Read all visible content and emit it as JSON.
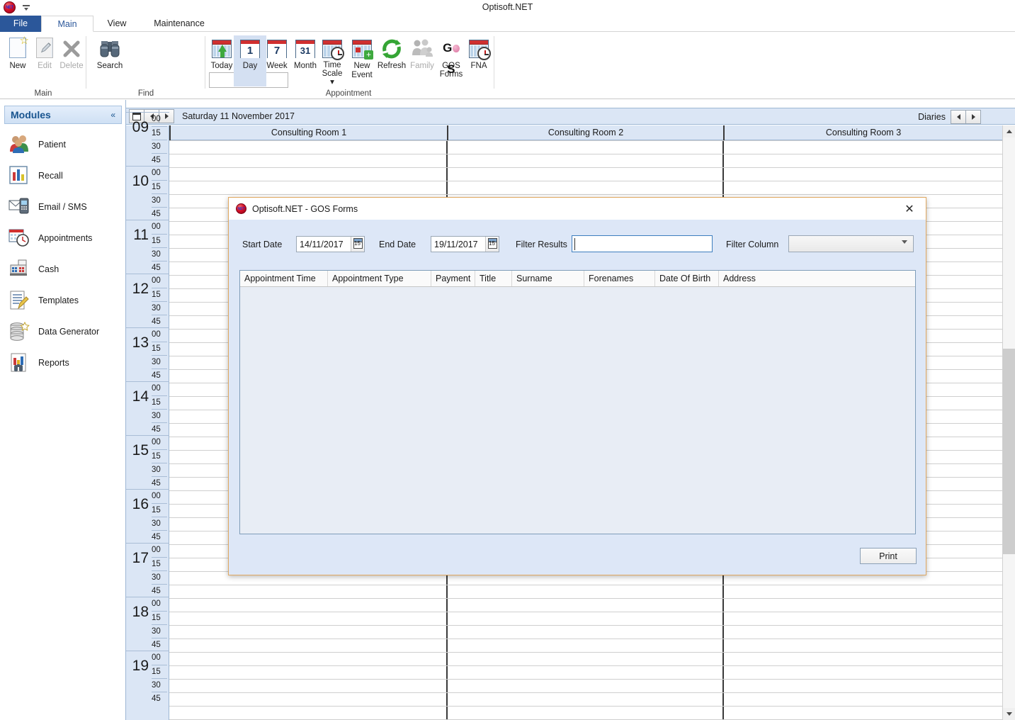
{
  "window": {
    "title": "Optisoft.NET",
    "app_icon": "app-orb-icon",
    "qat_dropdown": "customize-quick-access-icon"
  },
  "ribbon": {
    "tabs": [
      {
        "label": "File",
        "active": false
      },
      {
        "label": "Main",
        "active": true
      },
      {
        "label": "View",
        "active": false
      },
      {
        "label": "Maintenance",
        "active": false
      }
    ],
    "groups": [
      {
        "name": "Main",
        "label": "Main",
        "buttons": [
          {
            "label": "New",
            "icon": "new-page-icon",
            "enabled": true
          },
          {
            "label": "Edit",
            "icon": "edit-pencil-icon",
            "enabled": false
          },
          {
            "label": "Delete",
            "icon": "delete-x-icon",
            "enabled": false
          }
        ]
      },
      {
        "name": "Find",
        "label": "Find",
        "buttons": [
          {
            "label": "Search",
            "icon": "binoculars-icon",
            "enabled": true
          }
        ],
        "search_value": "",
        "search_placeholder": ""
      },
      {
        "name": "Appointment",
        "label": "Appointment",
        "buttons": [
          {
            "label": "Today",
            "icon": "calendar-today-icon",
            "enabled": true,
            "selected": false
          },
          {
            "label": "Day",
            "icon": "calendar-day-icon",
            "enabled": true,
            "selected": true
          },
          {
            "label": "Week",
            "icon": "calendar-week-icon",
            "enabled": true,
            "selected": false
          },
          {
            "label": "Month",
            "icon": "calendar-month-icon",
            "enabled": true,
            "selected": false
          },
          {
            "label": "Time Scale",
            "icon": "calendar-clock-icon",
            "enabled": true,
            "selected": false,
            "has_dropdown": true
          },
          {
            "label": "New Event",
            "icon": "calendar-add-icon",
            "enabled": true,
            "selected": false
          },
          {
            "label": "Refresh",
            "icon": "refresh-icon",
            "enabled": true,
            "selected": false
          },
          {
            "label": "Family",
            "icon": "family-icon",
            "enabled": false,
            "selected": false
          },
          {
            "label": "GOS Forms",
            "icon": "gos-icon",
            "enabled": true,
            "selected": false
          },
          {
            "label": "FNA",
            "icon": "calendar-clock-icon",
            "enabled": true,
            "selected": false
          }
        ]
      }
    ]
  },
  "sidebar": {
    "title": "Modules",
    "collapse_icon": "chevron-double-left-icon",
    "items": [
      {
        "label": "Patient",
        "icon": "patients-icon"
      },
      {
        "label": "Recall",
        "icon": "bar-chart-icon"
      },
      {
        "label": "Email / SMS",
        "icon": "email-sms-icon"
      },
      {
        "label": "Appointments",
        "icon": "appointments-calendar-clock-icon"
      },
      {
        "label": "Cash",
        "icon": "cash-register-icon"
      },
      {
        "label": "Templates",
        "icon": "templates-document-pencil-icon"
      },
      {
        "label": "Data Generator",
        "icon": "database-star-icon"
      },
      {
        "label": "Reports",
        "icon": "reports-icon"
      }
    ]
  },
  "calendar": {
    "prev_icon": "chevron-left-icon",
    "next_icon": "chevron-right-icon",
    "date_picker_icon": "mini-calendar-icon",
    "current_date": "Saturday 11 November 2017",
    "diaries_label": "Diaries",
    "diaries_prev_icon": "chevron-left-icon",
    "diaries_next_icon": "chevron-right-icon",
    "columns": [
      "Consulting Room 1",
      "Consulting Room 2",
      "Consulting Room 3"
    ],
    "hours": [
      "09",
      "10",
      "11",
      "12",
      "13",
      "14",
      "15",
      "16",
      "17",
      "18",
      "19"
    ],
    "minutes": [
      "00",
      "15",
      "30",
      "45"
    ],
    "scrollbar": {
      "up_icon": "scroll-up-icon",
      "down_icon": "scroll-down-icon"
    }
  },
  "dialog": {
    "title": "Optisoft.NET - GOS Forms",
    "icon": "app-orb-icon",
    "close_icon": "close-icon",
    "start_date_label": "Start Date",
    "start_date_value": "14/11/2017",
    "start_date_picker_icon": "calendar-picker-icon",
    "end_date_label": "End Date",
    "end_date_value": "19/11/2017",
    "end_date_picker_icon": "calendar-picker-icon",
    "filter_results_label": "Filter Results",
    "filter_results_value": "",
    "filter_column_label": "Filter Column",
    "filter_column_value": "",
    "filter_column_chevron_icon": "chevron-down-icon",
    "grid_columns": [
      "Appointment Time",
      "Appointment Type",
      "Payment",
      "Title",
      "Surname",
      "Forenames",
      "Date Of Birth",
      "Address"
    ],
    "grid_rows": [],
    "print_label": "Print"
  }
}
